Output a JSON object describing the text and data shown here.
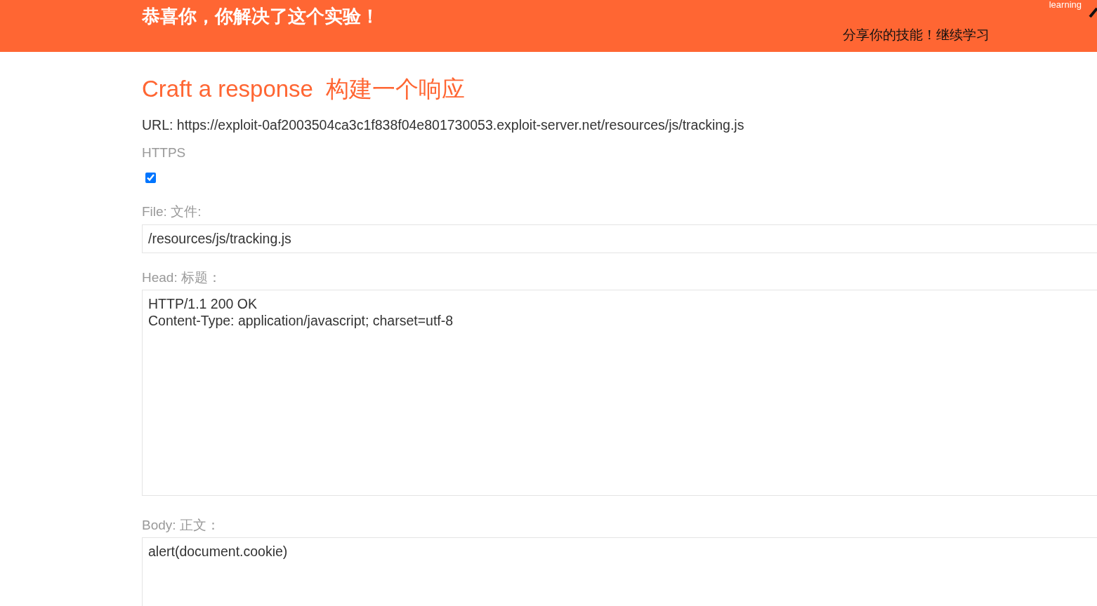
{
  "banner": {
    "title": "恭喜你，你解决了这个实验！",
    "link_text": "learning",
    "share_text": "分享你的技能！继续学习"
  },
  "heading": "Craft a response  构建一个响应",
  "url": "URL: https://exploit-0af2003504ca3c1f838f04e801730053.exploit-server.net/resources/js/tracking.js",
  "form": {
    "https": {
      "label": "HTTPS",
      "checked": true
    },
    "file": {
      "label": "File: 文件:",
      "value": "/resources/js/tracking.js"
    },
    "head": {
      "label": "Head: 标题：",
      "value": "HTTP/1.1 200 OK\nContent-Type: application/javascript; charset=utf-8"
    },
    "body": {
      "label": "Body: 正文：",
      "value": "alert(document.cookie)"
    }
  }
}
